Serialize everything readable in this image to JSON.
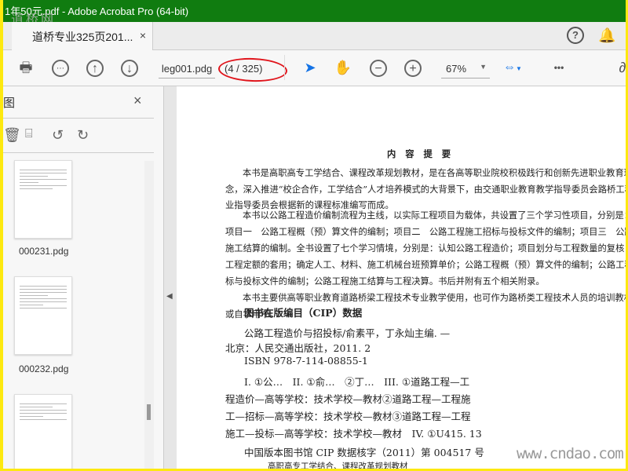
{
  "window": {
    "title": "1年50元.pdf - Adobe Acrobat Pro (64-bit)",
    "watermark": "道桥网"
  },
  "tab": {
    "label": "道桥专业325页201...",
    "close": "×"
  },
  "header": {
    "help": "?",
    "bell": "🔔"
  },
  "toolbar": {
    "page_label": "leg001.pdg",
    "page_count": "(4 / 325)",
    "zoom": "67%",
    "more": "•••"
  },
  "left_panel": {
    "title": "图",
    "close": "×",
    "thumbnails": [
      {
        "label": "000231.pdg"
      },
      {
        "label": "000232.pdg"
      },
      {
        "label": ""
      }
    ]
  },
  "document": {
    "heading": "内 容 提 要",
    "lines": [
      "本书是高职高专工学结合、课程改革规划教材，是在各高等职业院校积极践行和创新先进职业教育理",
      "念，深入推进“校企合作，工学结合”人才培养模式的大背景下，由交通职业教育教学指导委员会路桥工程专",
      "业指导委员会根据新的课程标准编写而成。",
      "本书以公路工程造价编制流程为主线，以实际工程项目为载体，共设置了三个学习性项目，分别是：",
      "项目一　公路工程概（预）算文件的编制；项目二　公路工程施工招标与投标文件的编制；项目三　公路工程",
      "施工结算的编制。全书设置了七个学习情境，分别是：认知公路工程造价；项目划分与工程数量的复核；公路",
      "工程定额的套用；确定人工、材料、施工机械台班预算单价；公路工程概（预）算文件的编制；公路工程施工招",
      "标与投标文件的编制；公路工程施工结算与工程决算。书后并附有五个相关附录。",
      "本书主要供高等职业教育道路桥梁工程技术专业教学使用，也可作为路桥类工程技术人员的培训教材",
      "或自学用书。"
    ],
    "cip_title": "图书在版编目（CIP）数据",
    "cip_lines": [
      "公路工程造价与招投标/俞素平，丁永灿主编. —",
      "北京：人民交通出版社，2011. 2",
      "ISBN 978-7-114-08855-1",
      "I. ①公…　II. ①俞…　②丁…　III. ①道路工程—工",
      "程造价—高等学校：技术学校—教材②道路工程—工程施",
      "工—招标—高等学校：技术学校—教材③道路工程—工程",
      "施工—投标—高等学校：技术学校—教材　IV. ①U415. 13",
      "中国版本图书馆 CIP 数据核字（2011）第 004517 号",
      "高职高专工学结合、课程改革规划教材"
    ],
    "site_watermark": "www.cndao.com"
  }
}
